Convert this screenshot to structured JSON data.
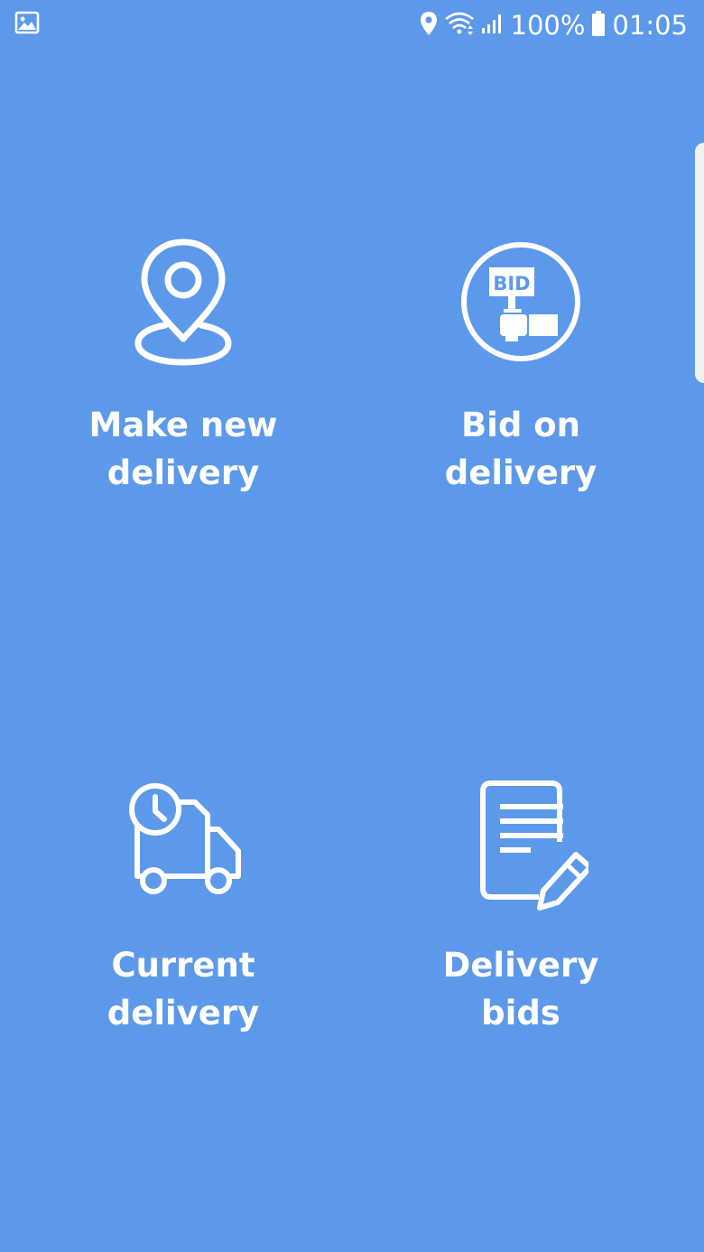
{
  "status_bar": {
    "battery_percent": "100%",
    "time": "01:05",
    "icons": [
      "image-icon",
      "location-icon",
      "wifi-icon",
      "signal-icon",
      "battery-icon"
    ]
  },
  "menu": {
    "make_new_delivery": {
      "icon": "location-pin-icon",
      "line1": "Make new",
      "line2": "delivery"
    },
    "bid_on_delivery": {
      "icon": "bid-sign-icon",
      "line1": "Bid on",
      "line2": "delivery"
    },
    "current_delivery": {
      "icon": "delivery-truck-clock-icon",
      "line1": "Current",
      "line2": "delivery"
    },
    "delivery_bids": {
      "icon": "document-edit-icon",
      "line1": "Delivery",
      "line2": "bids"
    }
  },
  "colors": {
    "background": "#5D99EA",
    "foreground": "#FFFFFF"
  }
}
